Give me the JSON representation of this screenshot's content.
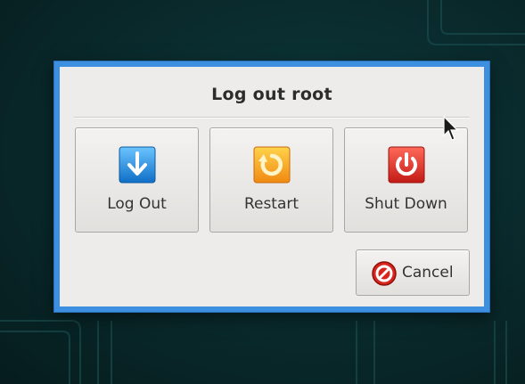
{
  "dialog": {
    "title": "Log out root",
    "buttons": {
      "logout": {
        "label": "Log Out",
        "icon": "arrow-down-icon"
      },
      "restart": {
        "label": "Restart",
        "icon": "restart-icon"
      },
      "shutdown": {
        "label": "Shut Down",
        "icon": "power-icon"
      },
      "cancel": {
        "label": "Cancel",
        "icon": "no-entry-icon"
      }
    }
  },
  "colors": {
    "dialog_border": "#3d8fe0",
    "logout_icon": "#1e8fe0",
    "restart_icon": "#f5a21c",
    "shutdown_icon": "#d9302a",
    "cancel_icon": "#d8261f"
  }
}
